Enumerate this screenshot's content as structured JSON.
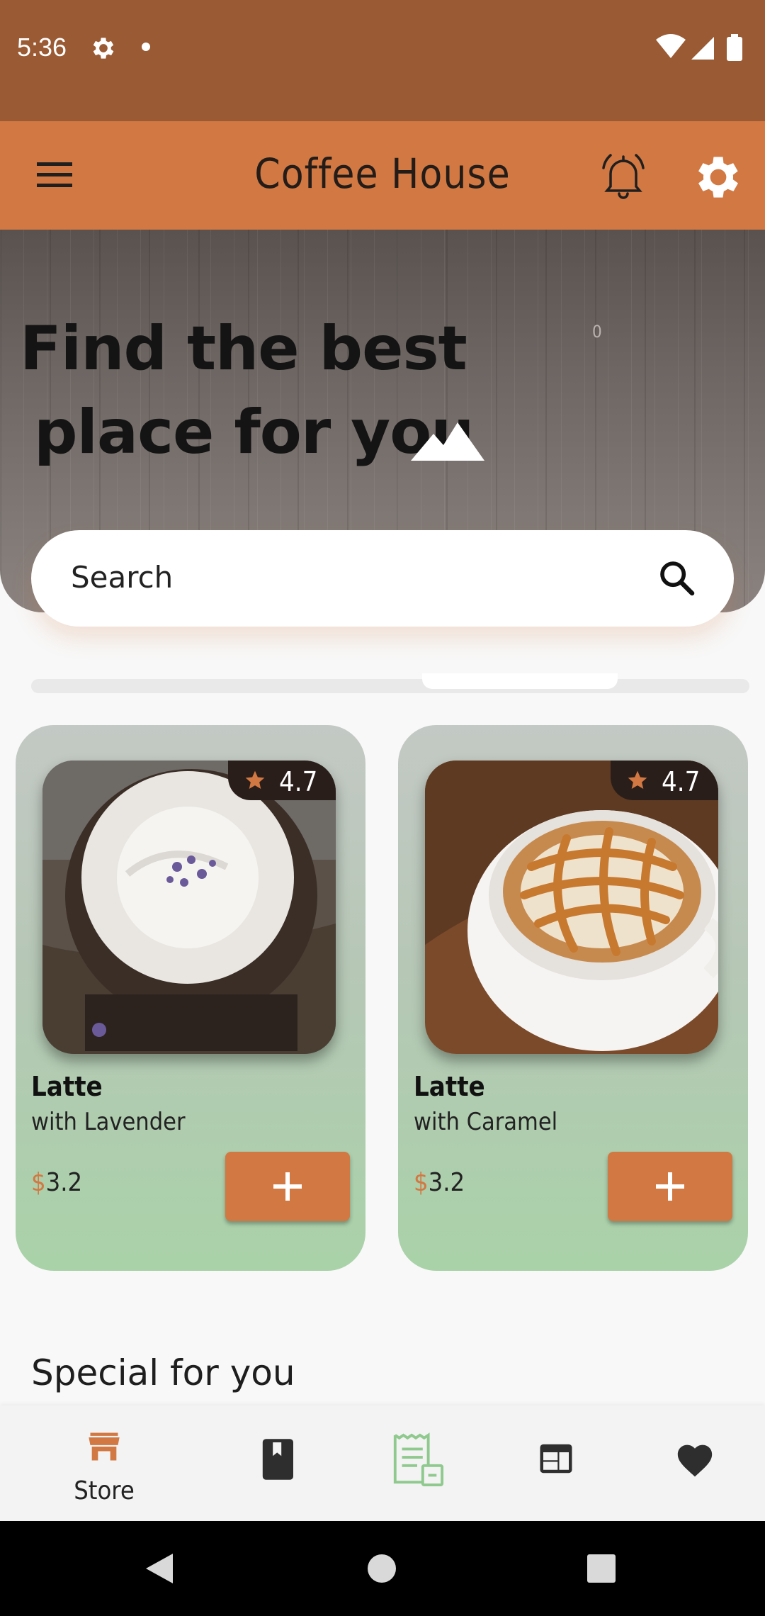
{
  "status_bar": {
    "time": "5:36"
  },
  "app_bar": {
    "title": "Coffee House"
  },
  "hero": {
    "line1": "Find the best",
    "line2": "place for you",
    "mark": "0"
  },
  "search": {
    "placeholder": "Search"
  },
  "products": [
    {
      "name": "Latte",
      "description": "with Lavender",
      "currency": "$",
      "price": "3.2",
      "rating": "4.7",
      "image": "lavender-latte-photo"
    },
    {
      "name": "Latte",
      "description": "with Caramel",
      "currency": "$",
      "price": "3.2",
      "rating": "4.7",
      "image": "caramel-latte-photo"
    }
  ],
  "special_section": {
    "title": "Special for you"
  },
  "bottom_nav": {
    "items": [
      {
        "label": "Store",
        "icon": "store-icon",
        "active": true
      },
      {
        "label": "",
        "icon": "book-icon"
      },
      {
        "label": "",
        "icon": "receipt-icon"
      },
      {
        "label": "",
        "icon": "calendar-grid-icon"
      },
      {
        "label": "",
        "icon": "heart-icon"
      }
    ]
  },
  "colors": {
    "status_bar": "#9a5a33",
    "app_bar": "#d27842",
    "accent": "#d27842",
    "card_green": "#a9d2a8",
    "rating_badge": "#2a1e1a",
    "receipt_icon_green": "#8fc98e"
  }
}
